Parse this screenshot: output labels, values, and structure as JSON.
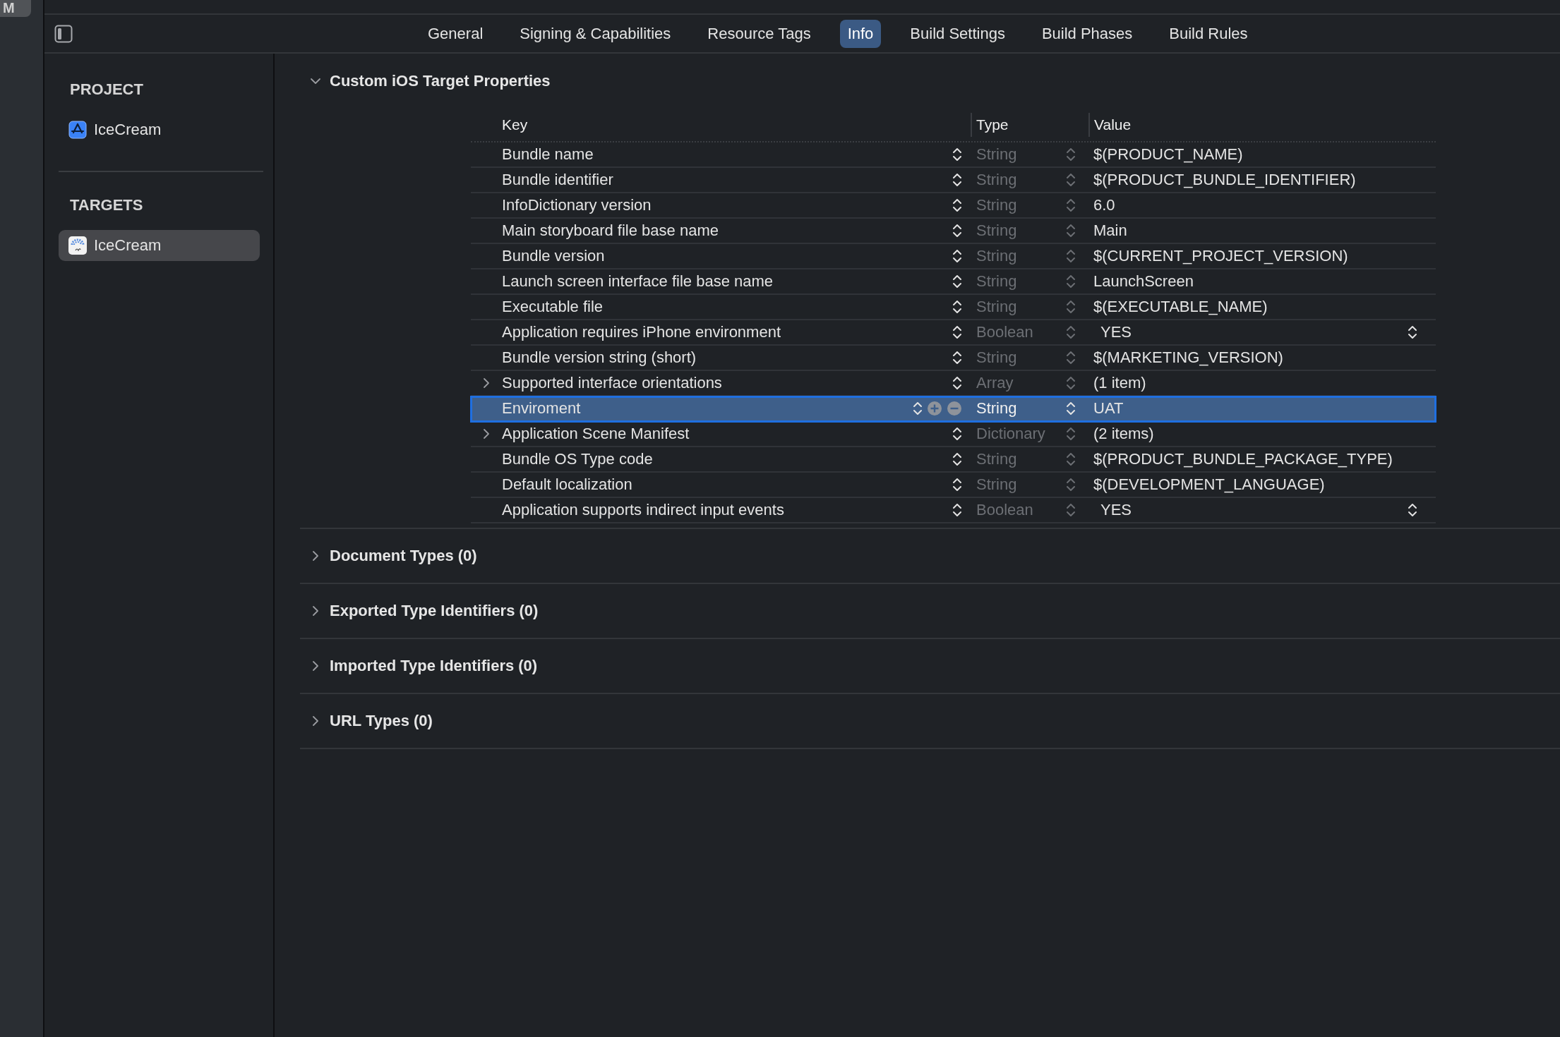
{
  "dock": {
    "letter": "M"
  },
  "tabs": [
    {
      "label": "General",
      "selected": false
    },
    {
      "label": "Signing & Capabilities",
      "selected": false
    },
    {
      "label": "Resource Tags",
      "selected": false
    },
    {
      "label": "Info",
      "selected": true
    },
    {
      "label": "Build Settings",
      "selected": false
    },
    {
      "label": "Build Phases",
      "selected": false
    },
    {
      "label": "Build Rules",
      "selected": false
    }
  ],
  "sidebar": {
    "sections": [
      {
        "heading": "PROJECT",
        "items": [
          {
            "label": "IceCream",
            "kind": "project",
            "selected": false
          }
        ]
      },
      {
        "heading": "TARGETS",
        "items": [
          {
            "label": "IceCream",
            "kind": "target",
            "selected": true
          }
        ]
      }
    ]
  },
  "properties": {
    "title": "Custom iOS Target Properties",
    "expanded": true,
    "columns": [
      "Key",
      "Type",
      "Value"
    ],
    "rows": [
      {
        "key": "Bundle name",
        "type": "String",
        "value": "$(PRODUCT_NAME)",
        "popup": false,
        "expandable": false,
        "selected": false
      },
      {
        "key": "Bundle identifier",
        "type": "String",
        "value": "$(PRODUCT_BUNDLE_IDENTIFIER)",
        "popup": false,
        "expandable": false,
        "selected": false
      },
      {
        "key": "InfoDictionary version",
        "type": "String",
        "value": "6.0",
        "popup": false,
        "expandable": false,
        "selected": false
      },
      {
        "key": "Main storyboard file base name",
        "type": "String",
        "value": "Main",
        "popup": false,
        "expandable": false,
        "selected": false
      },
      {
        "key": "Bundle version",
        "type": "String",
        "value": "$(CURRENT_PROJECT_VERSION)",
        "popup": false,
        "expandable": false,
        "selected": false
      },
      {
        "key": "Launch screen interface file base name",
        "type": "String",
        "value": "LaunchScreen",
        "popup": false,
        "expandable": false,
        "selected": false
      },
      {
        "key": "Executable file",
        "type": "String",
        "value": "$(EXECUTABLE_NAME)",
        "popup": false,
        "expandable": false,
        "selected": false
      },
      {
        "key": "Application requires iPhone environment",
        "type": "Boolean",
        "value": "YES",
        "popup": true,
        "expandable": false,
        "selected": false
      },
      {
        "key": "Bundle version string (short)",
        "type": "String",
        "value": "$(MARKETING_VERSION)",
        "popup": false,
        "expandable": false,
        "selected": false
      },
      {
        "key": "Supported interface orientations",
        "type": "Array",
        "value": "(1 item)",
        "popup": false,
        "expandable": true,
        "selected": false
      },
      {
        "key": "Enviroment",
        "type": "String",
        "value": "UAT",
        "popup": false,
        "expandable": false,
        "selected": true
      },
      {
        "key": "Application Scene Manifest",
        "type": "Dictionary",
        "value": "(2 items)",
        "popup": false,
        "expandable": true,
        "selected": false
      },
      {
        "key": "Bundle OS Type code",
        "type": "String",
        "value": "$(PRODUCT_BUNDLE_PACKAGE_TYPE)",
        "popup": false,
        "expandable": false,
        "selected": false
      },
      {
        "key": "Default localization",
        "type": "String",
        "value": "$(DEVELOPMENT_LANGUAGE)",
        "popup": false,
        "expandable": false,
        "selected": false
      },
      {
        "key": "Application supports indirect input events",
        "type": "Boolean",
        "value": "YES",
        "popup": true,
        "expandable": false,
        "selected": false
      }
    ]
  },
  "sections": [
    {
      "title": "Document Types (0)",
      "expanded": false
    },
    {
      "title": "Exported Type Identifiers (0)",
      "expanded": false
    },
    {
      "title": "Imported Type Identifiers (0)",
      "expanded": false
    },
    {
      "title": "URL Types (0)",
      "expanded": false
    }
  ]
}
